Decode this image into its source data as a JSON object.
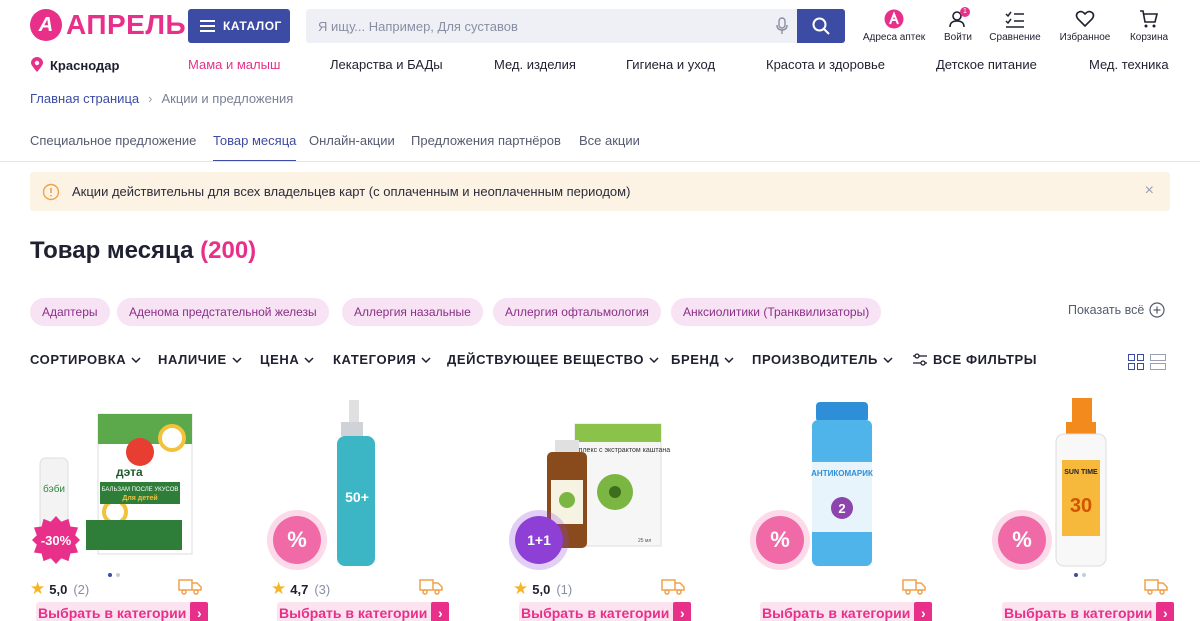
{
  "header": {
    "logo_letter": "А",
    "logo_text": "АПРЕЛЬ",
    "catalog_label": "КАТАЛОГ",
    "search_placeholder": "Я ищу... Например, Для суставов",
    "items": [
      {
        "label": "Адреса аптек",
        "icon": "pharmacy-logo-icon"
      },
      {
        "label": "Войти",
        "icon": "user-icon",
        "badge": "1"
      },
      {
        "label": "Сравнение",
        "icon": "compare-icon"
      },
      {
        "label": "Избранное",
        "icon": "heart-icon"
      },
      {
        "label": "Корзина",
        "icon": "cart-icon"
      }
    ],
    "accent_color": "#e8308a",
    "brand_blue": "#3c4ba3"
  },
  "nav": {
    "city": "Краснодар",
    "items": [
      "Мама и малыш",
      "Лекарства и БАДы",
      "Мед. изделия",
      "Гигиена и уход",
      "Красота и здоровье",
      "Детское питание",
      "Мед. техника"
    ]
  },
  "breadcrumb": {
    "home": "Главная страница",
    "current": "Акции и предложения"
  },
  "tabs": [
    "Специальное предложение",
    "Товар месяца",
    "Онлайн-акции",
    "Предложения партнёров",
    "Все акции"
  ],
  "active_tab": "Товар месяца",
  "notice": {
    "text": "Акции действительны для всех владельцев карт (с оплаченным и неоплаченным периодом)",
    "close": "×"
  },
  "title": {
    "text": "Товар месяца",
    "count": "(200)"
  },
  "chips": [
    "Адаптеры",
    "Аденома предстательной железы",
    "Аллергия назальные",
    "Аллергия офтальмология",
    "Анксиолитики (Транквилизаторы)"
  ],
  "show_all": "Показать всё",
  "filters": [
    "СОРТИРОВКА",
    "НАЛИЧИЕ",
    "ЦЕНА",
    "КАТЕГОРИЯ",
    "ДЕЙСТВУЮЩЕЕ ВЕЩЕСТВО",
    "БРЕНД",
    "ПРОИЗВОДИТЕЛЬ"
  ],
  "all_filters": "ВСЕ ФИЛЬТРЫ",
  "products": [
    {
      "promo": "-30%",
      "rating": "5,0",
      "reviews": "(2)",
      "cta": "Выбрать в категории"
    },
    {
      "promo": "%",
      "rating": "4,7",
      "reviews": "(3)",
      "cta": "Выбрать в категории"
    },
    {
      "promo": "1+1",
      "rating": "5,0",
      "reviews": "(1)",
      "cta": "Выбрать в категории"
    },
    {
      "promo": "%",
      "rating": "",
      "reviews": "",
      "cta": "Выбрать в категории"
    },
    {
      "promo": "%",
      "rating": "",
      "reviews": "",
      "cta": "Выбрать в категории"
    }
  ],
  "product_labels": {
    "p1_brand": "бэби",
    "p1_brand2": "дэта",
    "p1_box": "БАЛЬЗАМ ПОСЛЕ УКУСОВ",
    "p1_box2": "Для детей",
    "p2_label": "50+",
    "p3_box": "Комплекс с экстрактом каштана",
    "p3_ml": "25 мл",
    "p4_brand": "АНТИКОМАРИК",
    "p4_num": "2",
    "p5_brand": "SUN TIME",
    "p5_num": "30"
  }
}
